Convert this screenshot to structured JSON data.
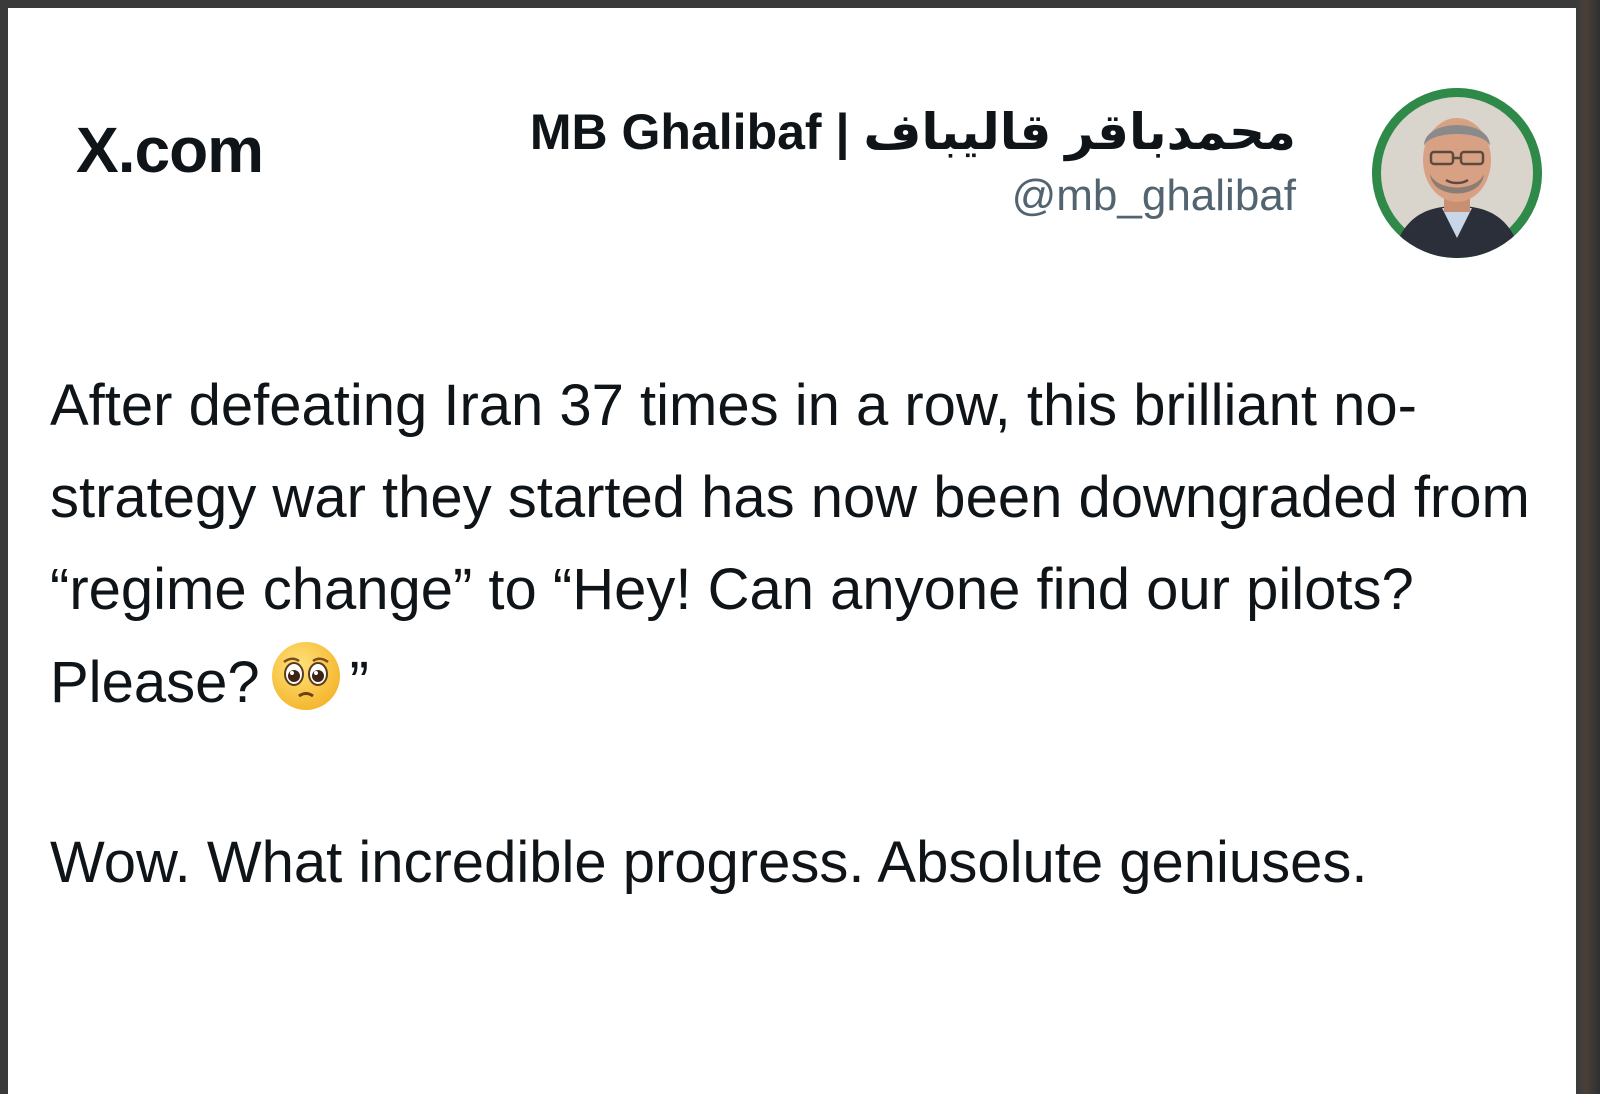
{
  "header": {
    "brand": "X.com",
    "display_name": "MB Ghalibaf | محمدباقر قالیباف",
    "handle": "@mb_ghalibaf",
    "avatar_icon": "profile-photo-icon",
    "avatar_ring_color": "#2f8a4a"
  },
  "tweet": {
    "paragraph_1_before_emoji": "After defeating Iran 37 times in a row, this brilliant no-strategy war they started has now been downgraded from “regime change” to “Hey! Can anyone find our pilots? Please?",
    "paragraph_1_after_emoji": "”",
    "emoji_icon": "pleading-face-icon",
    "paragraph_2": "Wow. What incredible progress. Absolute geniuses."
  }
}
